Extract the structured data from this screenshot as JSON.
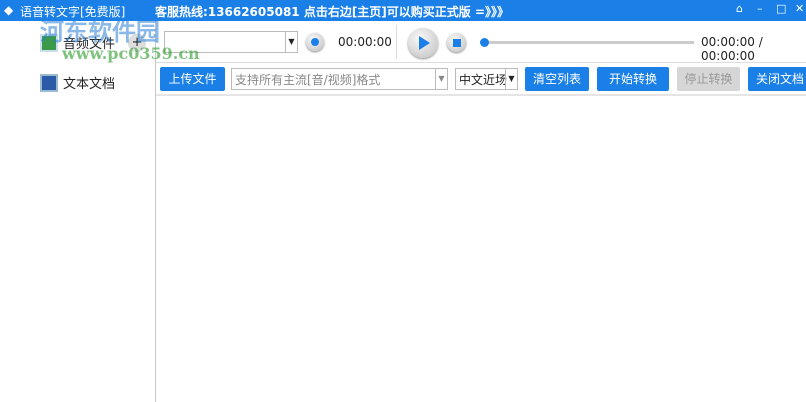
{
  "titlebar": {
    "app_title": "语音转文字[免费版]",
    "hotline": "客服热线:13662605081  点击右边[主页]可以购买正式版 =》》》",
    "home_icon": "⌂",
    "min_icon": "–",
    "max_icon": "□",
    "close_icon": "✕"
  },
  "sidebar": {
    "items": [
      {
        "label": "音频文件",
        "add": "+"
      },
      {
        "label": "文本文档"
      }
    ]
  },
  "player": {
    "file_select": "",
    "record_time": "00:00:00",
    "progress": 0,
    "position_time": "00:00:00 / 00:00:00"
  },
  "toolbar": {
    "upload": "上传文件",
    "format_placeholder": "支持所有主流[音/视频]格式",
    "language": "中文近场",
    "clear": "清空列表",
    "start": "开始转换",
    "stop": "停止转换",
    "close_doc": "关闭文档"
  },
  "watermark": {
    "text": "河东软件园",
    "url": "www.pc0359.cn"
  },
  "colors": {
    "accent": "#1a80e8"
  }
}
